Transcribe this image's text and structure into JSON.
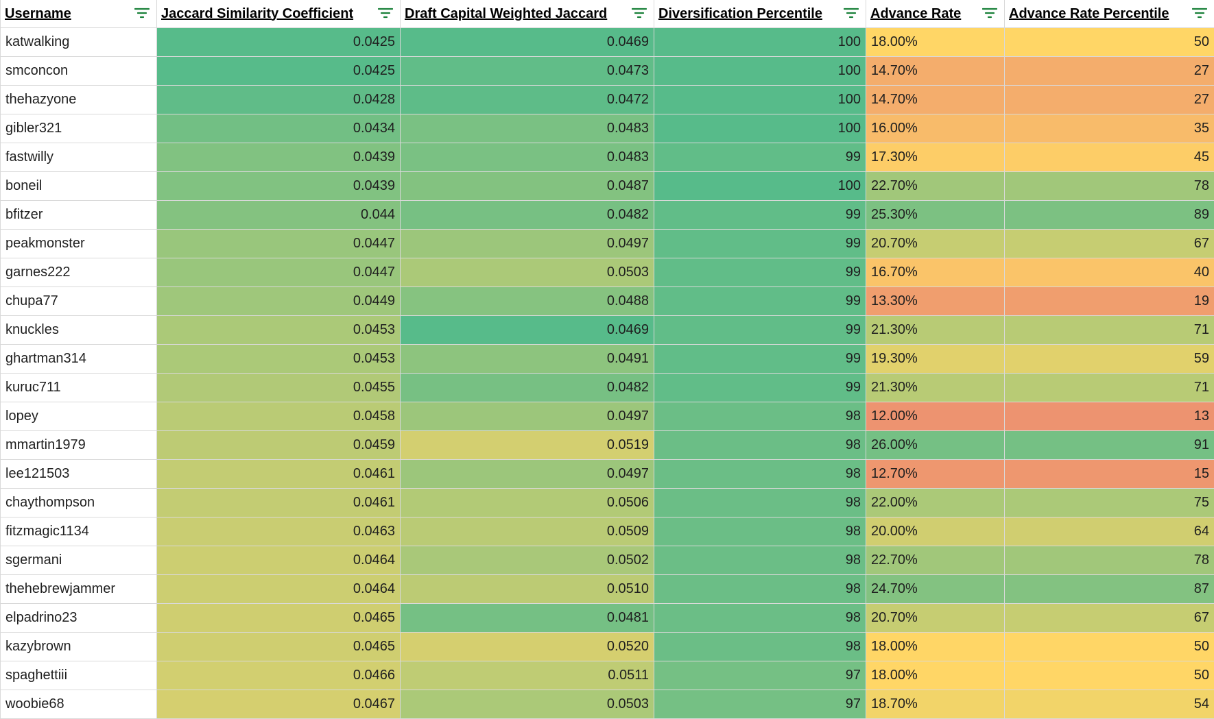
{
  "columns": [
    {
      "label": "Username"
    },
    {
      "label": "Jaccard Similarity Coefficient"
    },
    {
      "label": "Draft Capital Weighted Jaccard"
    },
    {
      "label": "Diversification Percentile"
    },
    {
      "label": "Advance Rate"
    },
    {
      "label": "Advance Rate Percentile"
    }
  ],
  "accent_colors": {
    "filter_icon": "#188038",
    "scale_green": "#57bb8a",
    "scale_yellow": "#ffd666",
    "scale_red": "#e67c73"
  },
  "rows": [
    {
      "username": "katwalking",
      "jaccard": "0.0425",
      "weighted": "0.0469",
      "div_pct": "100",
      "advance_rate": "18.00%",
      "adv_pct": "50"
    },
    {
      "username": "smconcon",
      "jaccard": "0.0425",
      "weighted": "0.0473",
      "div_pct": "100",
      "advance_rate": "14.70%",
      "adv_pct": "27"
    },
    {
      "username": "thehazyone",
      "jaccard": "0.0428",
      "weighted": "0.0472",
      "div_pct": "100",
      "advance_rate": "14.70%",
      "adv_pct": "27"
    },
    {
      "username": "gibler321",
      "jaccard": "0.0434",
      "weighted": "0.0483",
      "div_pct": "100",
      "advance_rate": "16.00%",
      "adv_pct": "35"
    },
    {
      "username": "fastwilly",
      "jaccard": "0.0439",
      "weighted": "0.0483",
      "div_pct": "99",
      "advance_rate": "17.30%",
      "adv_pct": "45"
    },
    {
      "username": "boneil",
      "jaccard": "0.0439",
      "weighted": "0.0487",
      "div_pct": "100",
      "advance_rate": "22.70%",
      "adv_pct": "78"
    },
    {
      "username": "bfitzer",
      "jaccard": "0.044",
      "weighted": "0.0482",
      "div_pct": "99",
      "advance_rate": "25.30%",
      "adv_pct": "89"
    },
    {
      "username": "peakmonster",
      "jaccard": "0.0447",
      "weighted": "0.0497",
      "div_pct": "99",
      "advance_rate": "20.70%",
      "adv_pct": "67"
    },
    {
      "username": "garnes222",
      "jaccard": "0.0447",
      "weighted": "0.0503",
      "div_pct": "99",
      "advance_rate": "16.70%",
      "adv_pct": "40"
    },
    {
      "username": "chupa77",
      "jaccard": "0.0449",
      "weighted": "0.0488",
      "div_pct": "99",
      "advance_rate": "13.30%",
      "adv_pct": "19"
    },
    {
      "username": "knuckles",
      "jaccard": "0.0453",
      "weighted": "0.0469",
      "div_pct": "99",
      "advance_rate": "21.30%",
      "adv_pct": "71"
    },
    {
      "username": "ghartman314",
      "jaccard": "0.0453",
      "weighted": "0.0491",
      "div_pct": "99",
      "advance_rate": "19.30%",
      "adv_pct": "59"
    },
    {
      "username": "kuruc711",
      "jaccard": "0.0455",
      "weighted": "0.0482",
      "div_pct": "99",
      "advance_rate": "21.30%",
      "adv_pct": "71"
    },
    {
      "username": "lopey",
      "jaccard": "0.0458",
      "weighted": "0.0497",
      "div_pct": "98",
      "advance_rate": "12.00%",
      "adv_pct": "13"
    },
    {
      "username": "mmartin1979",
      "jaccard": "0.0459",
      "weighted": "0.0519",
      "div_pct": "98",
      "advance_rate": "26.00%",
      "adv_pct": "91"
    },
    {
      "username": "lee121503",
      "jaccard": "0.0461",
      "weighted": "0.0497",
      "div_pct": "98",
      "advance_rate": "12.70%",
      "adv_pct": "15"
    },
    {
      "username": "chaythompson",
      "jaccard": "0.0461",
      "weighted": "0.0506",
      "div_pct": "98",
      "advance_rate": "22.00%",
      "adv_pct": "75"
    },
    {
      "username": "fitzmagic1134",
      "jaccard": "0.0463",
      "weighted": "0.0509",
      "div_pct": "98",
      "advance_rate": "20.00%",
      "adv_pct": "64"
    },
    {
      "username": "sgermani",
      "jaccard": "0.0464",
      "weighted": "0.0502",
      "div_pct": "98",
      "advance_rate": "22.70%",
      "adv_pct": "78"
    },
    {
      "username": "thehebrewjammer",
      "jaccard": "0.0464",
      "weighted": "0.0510",
      "div_pct": "98",
      "advance_rate": "24.70%",
      "adv_pct": "87"
    },
    {
      "username": "elpadrino23",
      "jaccard": "0.0465",
      "weighted": "0.0481",
      "div_pct": "98",
      "advance_rate": "20.70%",
      "adv_pct": "67"
    },
    {
      "username": "kazybrown",
      "jaccard": "0.0465",
      "weighted": "0.0520",
      "div_pct": "98",
      "advance_rate": "18.00%",
      "adv_pct": "50"
    },
    {
      "username": "spaghettiii",
      "jaccard": "0.0466",
      "weighted": "0.0511",
      "div_pct": "97",
      "advance_rate": "18.00%",
      "adv_pct": "50"
    },
    {
      "username": "woobie68",
      "jaccard": "0.0467",
      "weighted": "0.0503",
      "div_pct": "97",
      "advance_rate": "18.70%",
      "adv_pct": "54"
    }
  ]
}
